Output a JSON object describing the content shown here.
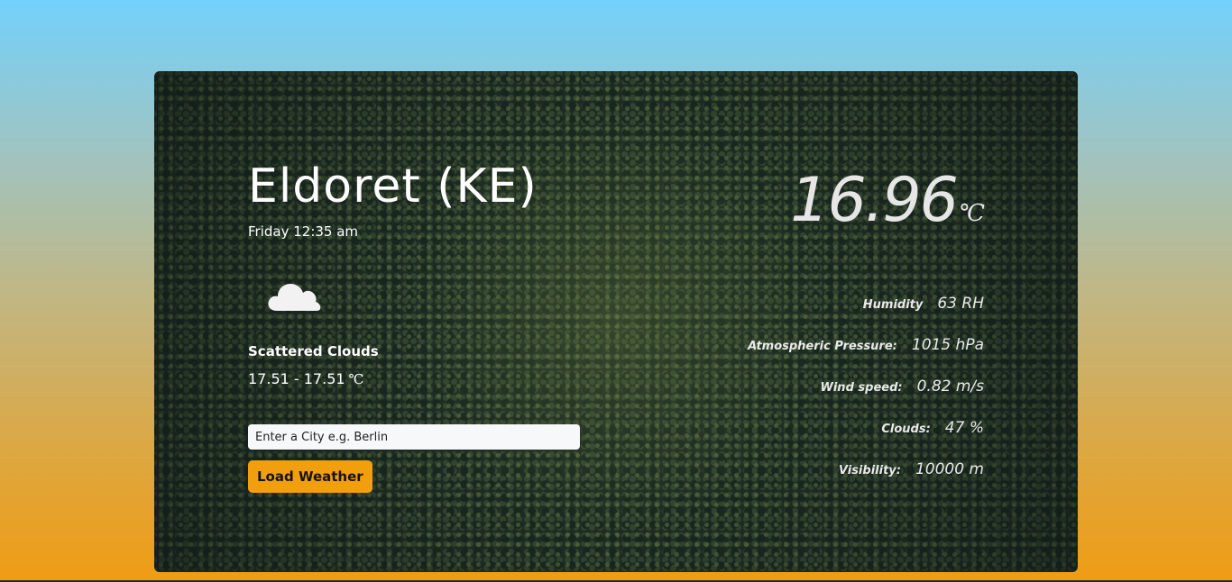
{
  "location": {
    "city": "Eldoret (KE)",
    "datetime": "Friday 12:35 am"
  },
  "weather": {
    "icon": "cloud-icon",
    "description": "Scattered Clouds",
    "temp_range": "17.51 - 17.51",
    "range_unit": "℃",
    "temperature": "16.96",
    "temperature_unit": "℃"
  },
  "search": {
    "placeholder": "Enter a City e.g. Berlin",
    "value": ""
  },
  "load_button": {
    "label": "Load Weather"
  },
  "stats": [
    {
      "label": "Humidity",
      "value": "63 RH"
    },
    {
      "label": "Atmospheric Pressure:",
      "value": "1015 hPa"
    },
    {
      "label": "Wind speed:",
      "value": "0.82 m/s"
    },
    {
      "label": "Clouds:",
      "value": "47 %"
    },
    {
      "label": "Visibility:",
      "value": "10000 m"
    }
  ],
  "colors": {
    "accent": "#f19e0f",
    "sky_top": "#73d1fb",
    "sky_bottom": "#f09c14"
  }
}
